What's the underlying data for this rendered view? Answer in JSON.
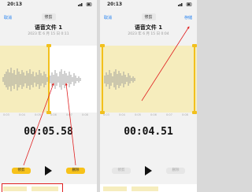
{
  "left": {
    "status_time": "20:13",
    "cancel": "取消",
    "header": "修剪",
    "title": "语音文件 1",
    "subtitle": "2023 年 6 月 15 日 0:11",
    "ticks": [
      "0:03",
      "0:04",
      "0:05",
      "0:06",
      "0:07",
      "0:08"
    ],
    "timer": "00:05.58",
    "trim_label": "修剪",
    "delete_label": "删除"
  },
  "right": {
    "status_time": "20:13",
    "cancel": "取消",
    "header": "修剪",
    "save": "存储",
    "title": "语音文件 1",
    "subtitle": "2023 年 6 月 15 日 0:04",
    "ticks": [
      "0:03",
      "0:04",
      "0:05",
      "0:06",
      "0:07",
      "0:08"
    ],
    "timer": "00:04.51",
    "trim_label": "修剪",
    "delete_label": "删除"
  },
  "colors": {
    "accent": "#1a7cf0",
    "trim_yellow": "#f2c01c",
    "annotation_red": "#e02020"
  }
}
